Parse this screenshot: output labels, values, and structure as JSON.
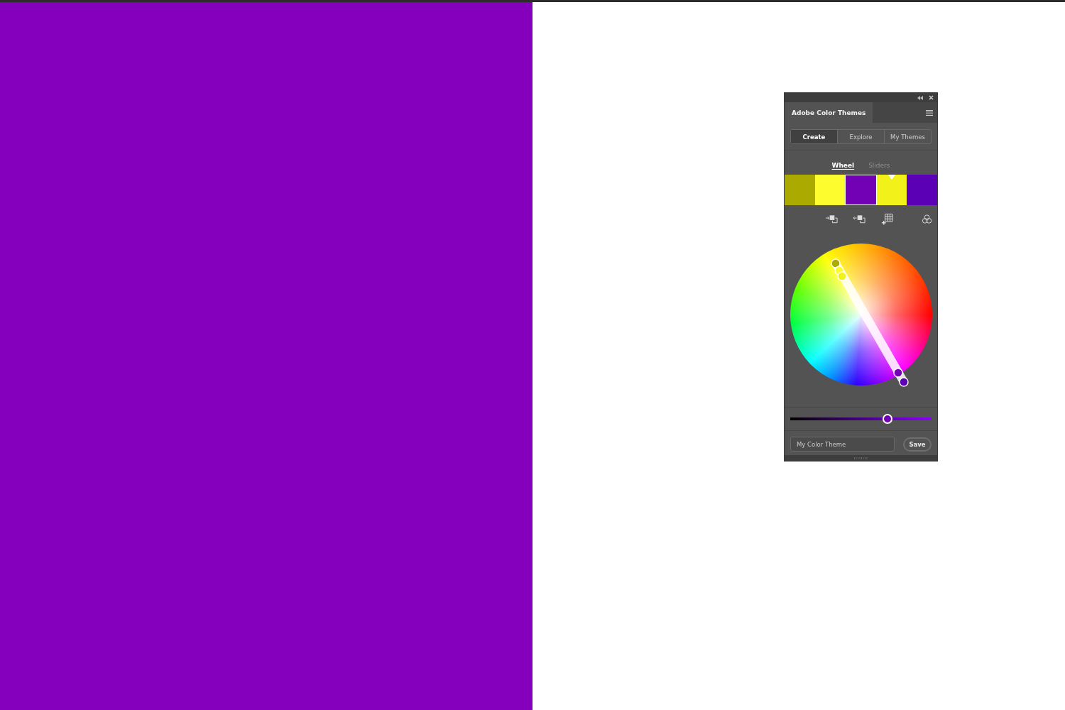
{
  "panel": {
    "title": "Adobe Color Themes",
    "modes": [
      {
        "label": "Create",
        "selected": true
      },
      {
        "label": "Explore",
        "selected": false
      },
      {
        "label": "My Themes",
        "selected": false
      }
    ],
    "views": [
      {
        "label": "Wheel",
        "selected": true
      },
      {
        "label": "Sliders",
        "selected": false
      }
    ],
    "swatches": [
      {
        "color": "#aaaa00",
        "selected": false,
        "base": false
      },
      {
        "color": "#fcfc2e",
        "selected": false,
        "base": false
      },
      {
        "color": "#7200b5",
        "selected": true,
        "base": false
      },
      {
        "color": "#f2f21a",
        "selected": false,
        "base": true
      },
      {
        "color": "#5b00b5",
        "selected": false,
        "base": false
      }
    ],
    "brightness": {
      "level": 0.69
    },
    "theme_name": {
      "placeholder": "My Color Theme"
    },
    "save_button": "Save"
  }
}
